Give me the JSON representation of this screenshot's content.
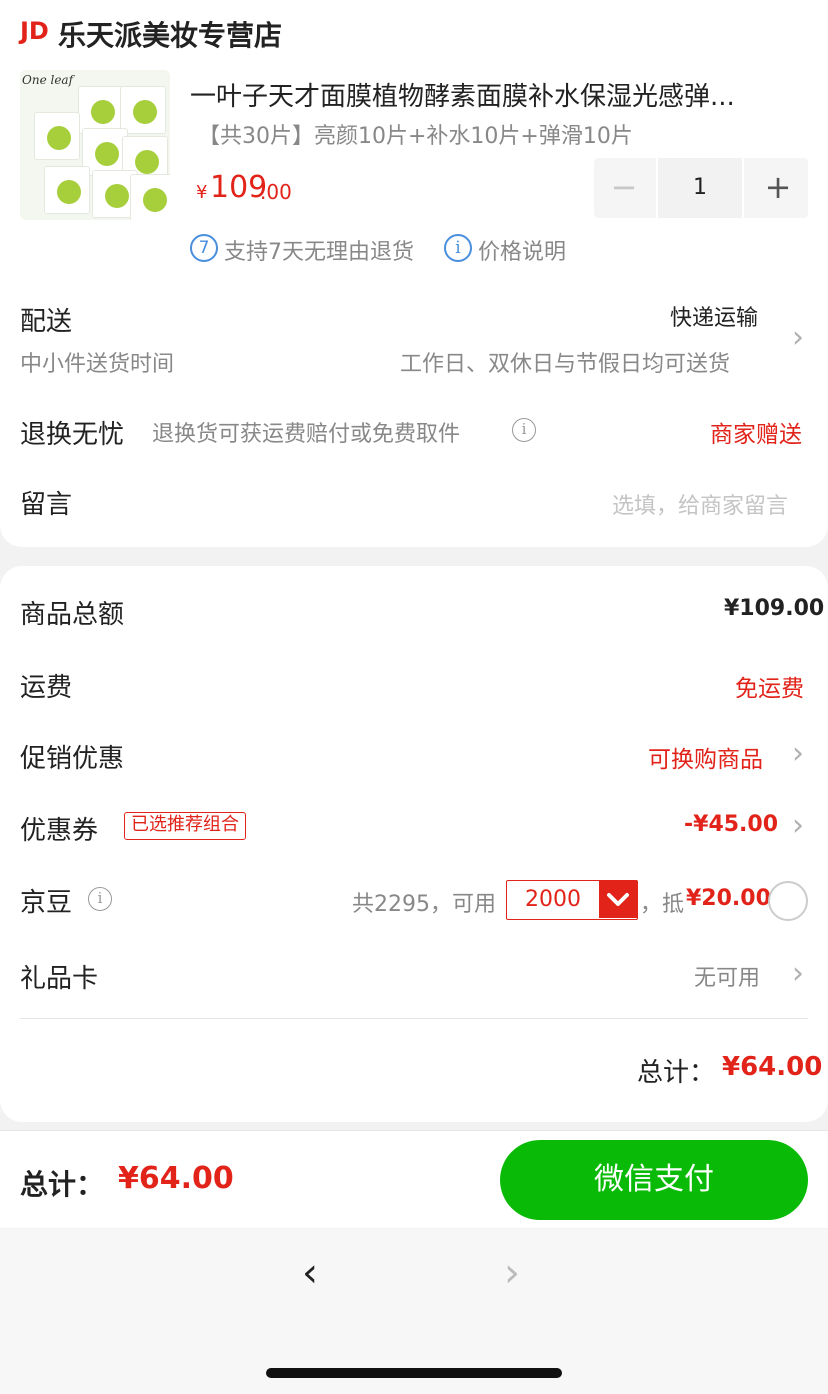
{
  "header": {
    "logo": "JD",
    "store_name": "乐天派美妆专营店"
  },
  "product": {
    "thumbnail_brand": "One leaf",
    "title": "一叶子天才面膜植物酵素面膜补水保湿光感弹...",
    "spec": "【共30片】亮颜10片+补水10片+弹滑10片",
    "price_symbol": "¥",
    "price_integer": "109",
    "price_decimal": ".00",
    "quantity": "1",
    "minus": "−",
    "plus": "+",
    "return_badge": "7",
    "return_text": "支持7天无理由退货",
    "price_info_icon": "i",
    "price_info_text": "价格说明"
  },
  "delivery": {
    "label": "配送",
    "method": "快递运输",
    "time_label": "中小件送货时间",
    "time_value": "工作日、双休日与节假日均可送货"
  },
  "return_worry": {
    "label": "退换无忧",
    "desc": "退换货可获运费赔付或免费取件",
    "value": "商家赠送"
  },
  "message": {
    "label": "留言",
    "placeholder": "选填，给商家留言"
  },
  "summary": {
    "goods_total_label": "商品总额",
    "goods_total_value": "¥109.00",
    "shipping_label": "运费",
    "shipping_value": "免运费",
    "promo_label": "促销优惠",
    "promo_value": "可换购商品",
    "coupon_label": "优惠券",
    "coupon_tag": "已选推荐组合",
    "coupon_value": "-¥45.00",
    "beans_label": "京豆",
    "beans_total_text": "共2295，可用",
    "beans_input": "2000",
    "beans_offset_prefix": "，抵",
    "beans_offset_value": "¥20.00",
    "giftcard_label": "礼品卡",
    "giftcard_value": "无可用",
    "total_label": "总计：",
    "total_value": "¥64.00"
  },
  "bottom": {
    "total_label": "总计：",
    "total_value": "¥64.00",
    "pay_button": "微信支付"
  },
  "nav": {
    "back": "‹",
    "forward": "›"
  },
  "colors": {
    "accent_red": "#e2231a",
    "wechat_green": "#09bb07",
    "link_blue": "#4a8ede"
  }
}
